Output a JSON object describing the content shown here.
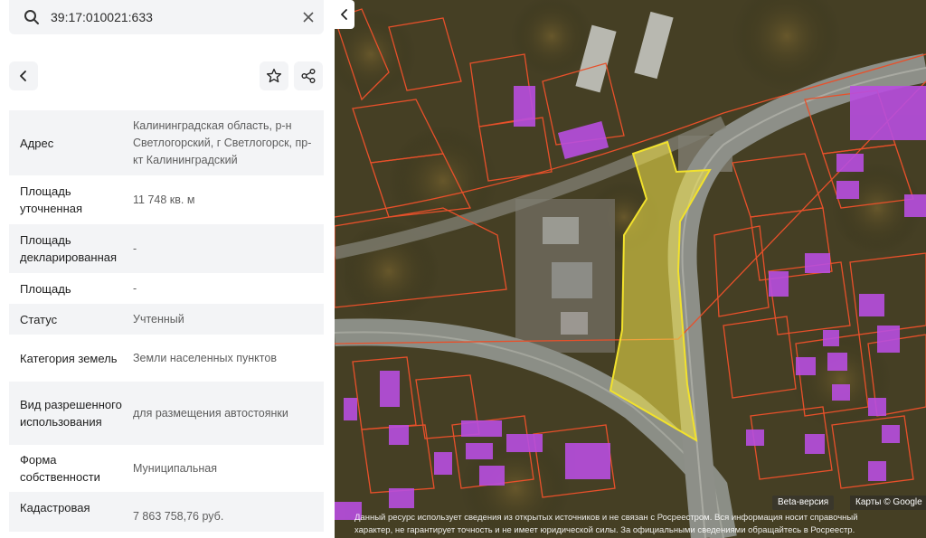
{
  "search": {
    "value": "39:17:010021:633"
  },
  "icons": {
    "search": "search-icon",
    "clear": "close-icon",
    "back": "chevron-left-icon",
    "favorite": "star-icon",
    "share": "share-icon",
    "collapse": "chevron-left-icon"
  },
  "info_rows": [
    {
      "label": "Адрес",
      "value": "Калининградская область, р-н Светлогорский, г Светлогорск, пр-кт Калининградский"
    },
    {
      "label": "Площадь уточненная",
      "value": "11 748 кв. м"
    },
    {
      "label": "Площадь декларированная",
      "value": "-"
    },
    {
      "label": "Площадь",
      "value": "-"
    },
    {
      "label": "Статус",
      "value": "Учтенный"
    },
    {
      "label": "Категория земель",
      "value": "Земли населенных пунктов"
    },
    {
      "label": "Вид разрешенного использования",
      "value": "для размещения автостоянки"
    },
    {
      "label": "Форма собственности",
      "value": "Муниципальная"
    },
    {
      "label": "Кадастровая",
      "value": "7 863 758,76 руб."
    }
  ],
  "map": {
    "beta_label": "Beta-версия",
    "attribution": "Карты © Google",
    "disclaimer_line1": "Данный ресурс использует сведения из открытых источников и не связан с Росреестром. Вся информация носит справочный",
    "disclaimer_line2": "характер, не гарантирует точность и не имеет юридической силы. За официальными сведениями обращайтесь в Росреестр.",
    "colors": {
      "parcel_outline": "#e8502a",
      "building": "#b84ee0",
      "selected_parcel": "#f4e64a"
    }
  }
}
